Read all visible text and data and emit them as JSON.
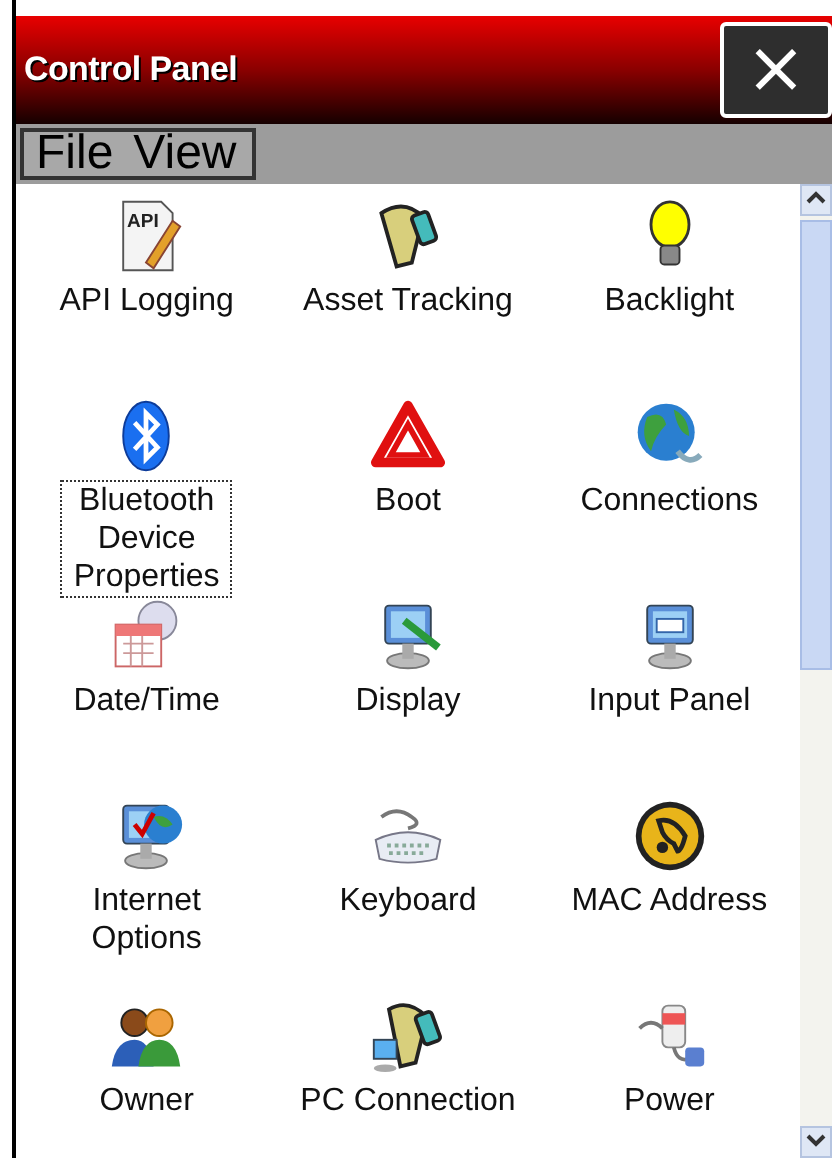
{
  "window": {
    "title": "Control Panel",
    "close_glyph": "×"
  },
  "menu": [
    {
      "label": "File"
    },
    {
      "label": "View"
    }
  ],
  "applets": [
    {
      "label": "API Logging",
      "selected": false,
      "icon_text": "API"
    },
    {
      "label": "Asset Tracking",
      "selected": false
    },
    {
      "label": "Backlight",
      "selected": false
    },
    {
      "label": "Bluetooth Device Properties",
      "selected": true
    },
    {
      "label": "Boot",
      "selected": false
    },
    {
      "label": "Connections",
      "selected": false
    },
    {
      "label": "Date/Time",
      "selected": false
    },
    {
      "label": "Display",
      "selected": false
    },
    {
      "label": "Input Panel",
      "selected": false
    },
    {
      "label": "Internet Options",
      "selected": false
    },
    {
      "label": "Keyboard",
      "selected": false
    },
    {
      "label": "MAC Address",
      "selected": false
    },
    {
      "label": "Owner",
      "selected": false
    },
    {
      "label": "PC Connection",
      "selected": false
    },
    {
      "label": "Power",
      "selected": false
    }
  ]
}
